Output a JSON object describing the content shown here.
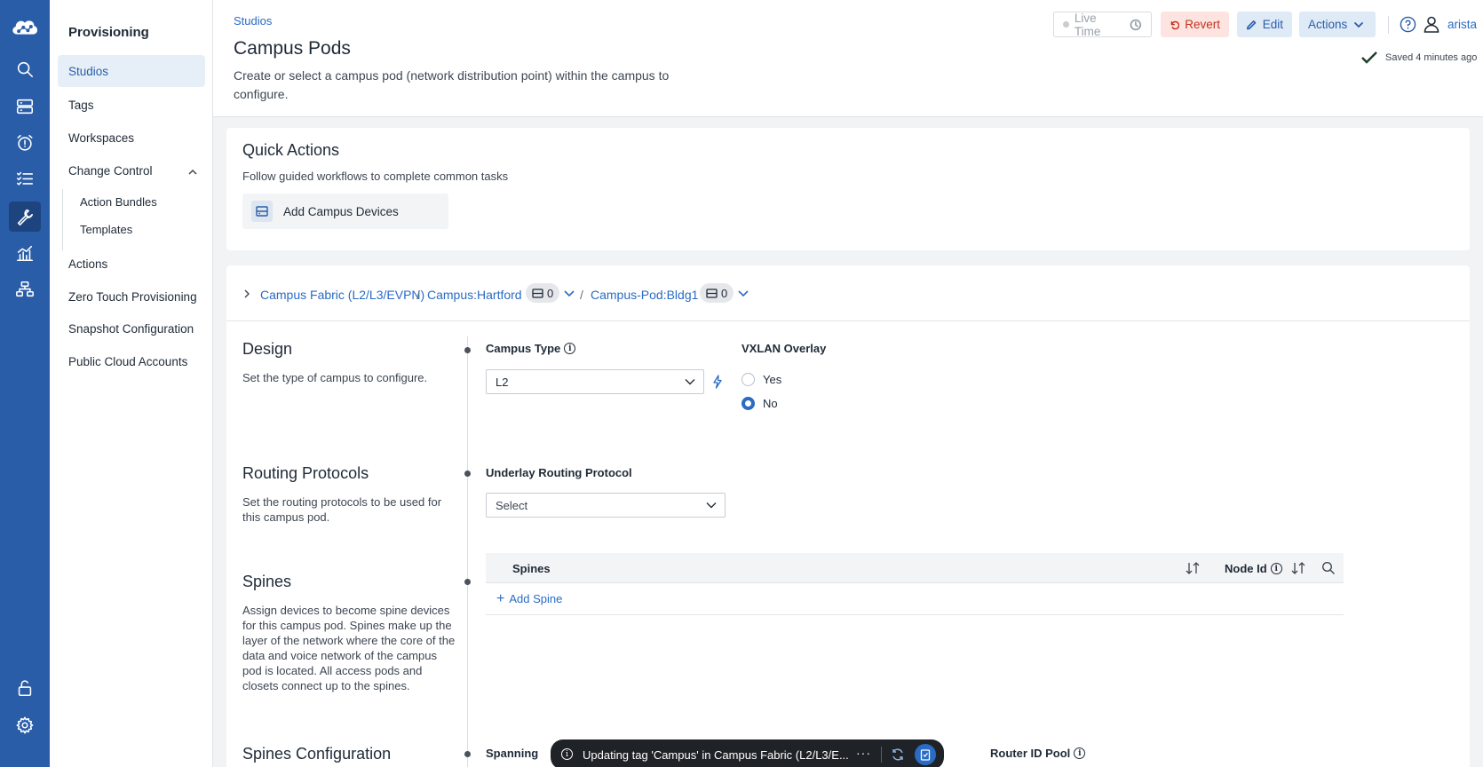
{
  "rail": {
    "items": [
      "cloud-logo-icon",
      "search-icon",
      "devices-icon",
      "alarm-icon",
      "checklist-icon",
      "wrench-icon",
      "dashboard-chart-icon",
      "topology-icon",
      "unlock-icon",
      "gear-icon"
    ],
    "active": "wrench-icon"
  },
  "nav": {
    "title": "Provisioning",
    "items": [
      {
        "label": "Studios",
        "active": true
      },
      {
        "label": "Tags"
      },
      {
        "label": "Workspaces"
      },
      {
        "label": "Change Control",
        "expanded": true
      },
      {
        "label": "Actions"
      },
      {
        "label": "Zero Touch Provisioning"
      },
      {
        "label": "Snapshot Configuration"
      },
      {
        "label": "Public Cloud Accounts"
      }
    ],
    "change_control_children": [
      "Action Bundles",
      "Templates"
    ]
  },
  "header": {
    "breadcrumb": "Studios",
    "title": "Campus Pods",
    "description": "Create or select a campus pod (network distribution point) within the campus to configure.",
    "live_time_label": "Live Time",
    "revert_label": "Revert",
    "edit_label": "Edit",
    "actions_label": "Actions",
    "user": "arista",
    "saved_status": "Saved 4 minutes ago"
  },
  "quick_actions": {
    "title": "Quick Actions",
    "description": "Follow guided workflows to complete common tasks",
    "buttons": [
      "Add Campus Devices"
    ]
  },
  "path": {
    "crumbs": [
      "Campus Fabric (L2/L3/EVPN)",
      "Campus:Hartford",
      "Campus-Pod:Bldg1"
    ],
    "badges": [
      "0",
      "0"
    ]
  },
  "sections": {
    "design": {
      "title": "Design",
      "description": "Set the type of campus to configure.",
      "campus_type_label": "Campus Type",
      "campus_type_value": "L2",
      "vxlan_label": "VXLAN Overlay",
      "vxlan_options": [
        "Yes",
        "No"
      ],
      "vxlan_selected": "No"
    },
    "routing": {
      "title": "Routing Protocols",
      "description": "Set the routing protocols to be used for this campus pod.",
      "underlay_label": "Underlay Routing Protocol",
      "underlay_placeholder": "Select"
    },
    "spines": {
      "title": "Spines",
      "description": "Assign devices to become spine devices for this campus pod. Spines make up the layer of the network where the core of the data and voice network of the campus pod is located. All access pods and closets connect up to the spines.",
      "columns": [
        "Spines",
        "Node Id"
      ],
      "add_label": "Add Spine"
    },
    "spines_config": {
      "title": "Spines Configuration",
      "spanning_label": "Spanning",
      "router_id_label": "Router ID Pool"
    }
  },
  "toast": {
    "message": "Updating tag 'Campus' in Campus Fabric (L2/L3/E..."
  }
}
